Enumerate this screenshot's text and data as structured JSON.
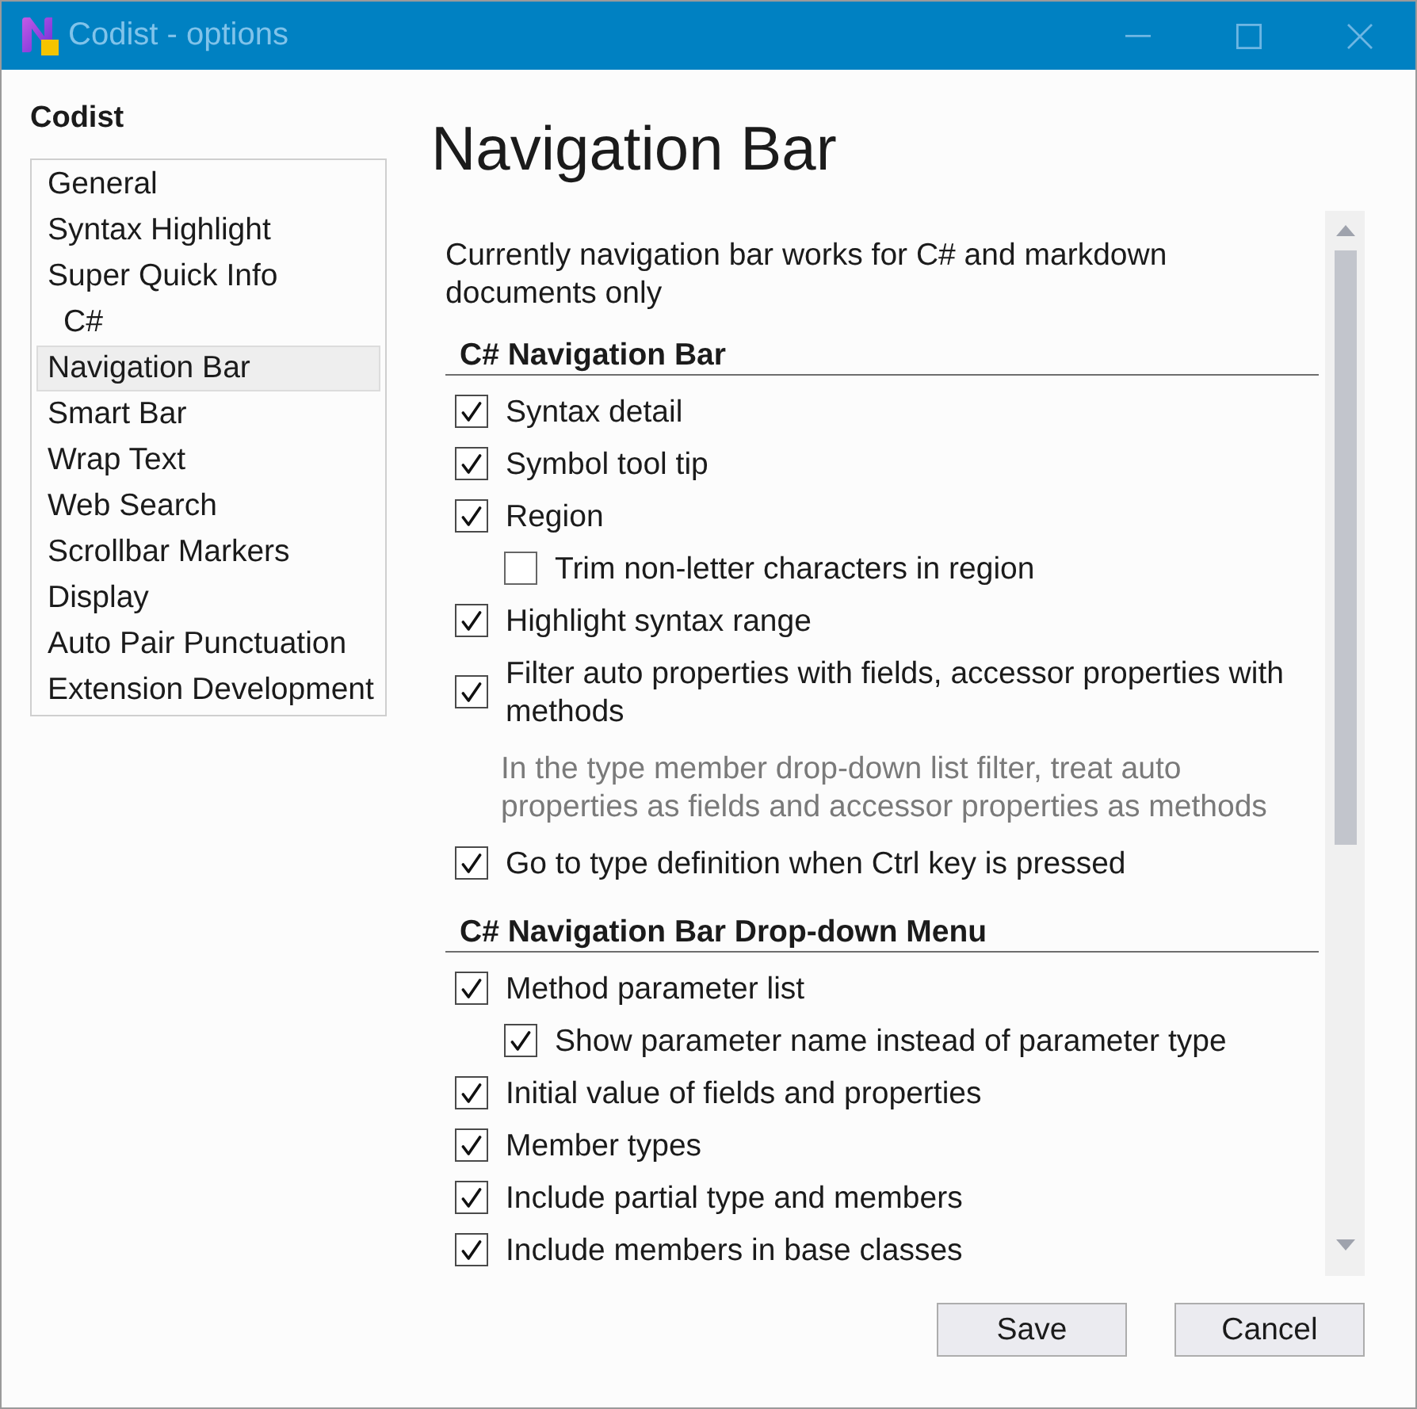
{
  "window": {
    "title": "Codist - options"
  },
  "sidebar": {
    "title": "Codist",
    "items": [
      {
        "label": "General",
        "selected": false
      },
      {
        "label": "Syntax Highlight",
        "selected": false
      },
      {
        "label": "Super Quick Info",
        "selected": false,
        "children": [
          {
            "label": "C#",
            "selected": false
          }
        ]
      },
      {
        "label": "Navigation Bar",
        "selected": true
      },
      {
        "label": "Smart Bar",
        "selected": false
      },
      {
        "label": "Wrap Text",
        "selected": false
      },
      {
        "label": "Web Search",
        "selected": false
      },
      {
        "label": "Scrollbar Markers",
        "selected": false
      },
      {
        "label": "Display",
        "selected": false
      },
      {
        "label": "Auto Pair Punctuation",
        "selected": false
      },
      {
        "label": "Extension Development",
        "selected": false
      }
    ]
  },
  "page": {
    "title": "Navigation Bar",
    "intro": "Currently navigation bar works for C# and markdown documents only",
    "sections": [
      {
        "title": "C# Navigation Bar",
        "options": [
          {
            "label": "Syntax detail",
            "checked": true
          },
          {
            "label": "Symbol tool tip",
            "checked": true
          },
          {
            "label": "Region",
            "checked": true,
            "children": [
              {
                "label": "Trim non-letter characters in region",
                "checked": false
              }
            ]
          },
          {
            "label": "Highlight syntax range",
            "checked": true
          },
          {
            "label": "Filter auto properties with fields, accessor properties with methods",
            "checked": true,
            "note": "In the type member drop-down list filter, treat auto properties as fields and accessor properties as methods"
          },
          {
            "label": "Go to type definition when Ctrl key is pressed",
            "checked": true
          }
        ]
      },
      {
        "title": "C# Navigation Bar Drop-down Menu",
        "options": [
          {
            "label": "Method parameter list",
            "checked": true,
            "children": [
              {
                "label": "Show parameter name instead of parameter type",
                "checked": true
              }
            ]
          },
          {
            "label": "Initial value of fields and properties",
            "checked": true
          },
          {
            "label": "Member types",
            "checked": true
          },
          {
            "label": "Include partial type and members",
            "checked": true
          },
          {
            "label": "Include members in base classes",
            "checked": true
          }
        ]
      }
    ]
  },
  "buttons": [
    "Save",
    "Cancel"
  ]
}
